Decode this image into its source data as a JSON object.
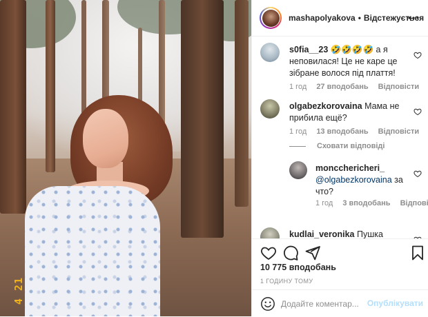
{
  "photo": {
    "alt_subject": "",
    "date_stamp": "4 21"
  },
  "header": {
    "username": "mashapolyakova",
    "dot": "•",
    "follow_label": "Відстежується",
    "more_icon": "more-horizontal-icon"
  },
  "comments": [
    {
      "username": "s0fia__23",
      "text": " 🤣🤣🤣🤣 а я неповилася! Це не каре це зібране волося під плаття!",
      "time": "1 год",
      "likes": "27 вподобань",
      "reply": "Відповісти",
      "avatar_color": "#a7b7c3"
    },
    {
      "username": "olgabezkorovaina",
      "text": " Мама не прибила ещё?",
      "time": "1 год",
      "likes": "13 вподобань",
      "reply": "Відповісти",
      "avatar_color": "#7d7a62"
    }
  ],
  "hide_replies_label": "Сховати відповіді",
  "reply": {
    "username": "moncchericheri_",
    "mention": "@olgabezkorovaina",
    "text": " за что?",
    "time": "1 год",
    "likes": "3 вподобань",
    "reply": "Відповісти",
    "avatar_color": "#6f6a6c"
  },
  "partial_comment": {
    "username": "kudlai_veronika",
    "text": " Пушка",
    "avatar_color": "#8a8a7a"
  },
  "actions": {
    "like_icon": "heart-icon",
    "comment_icon": "comment-icon",
    "share_icon": "paper-plane-icon",
    "save_icon": "bookmark-icon",
    "likes_count": "10 775 вподобань",
    "time_ago": "1 ГОДИНУ ТОМУ"
  },
  "add_comment": {
    "emoji_icon": "smiley-icon",
    "placeholder": "Додайте коментар...",
    "post_label": "Опублікувати",
    "post_color": "#b2dffc"
  }
}
